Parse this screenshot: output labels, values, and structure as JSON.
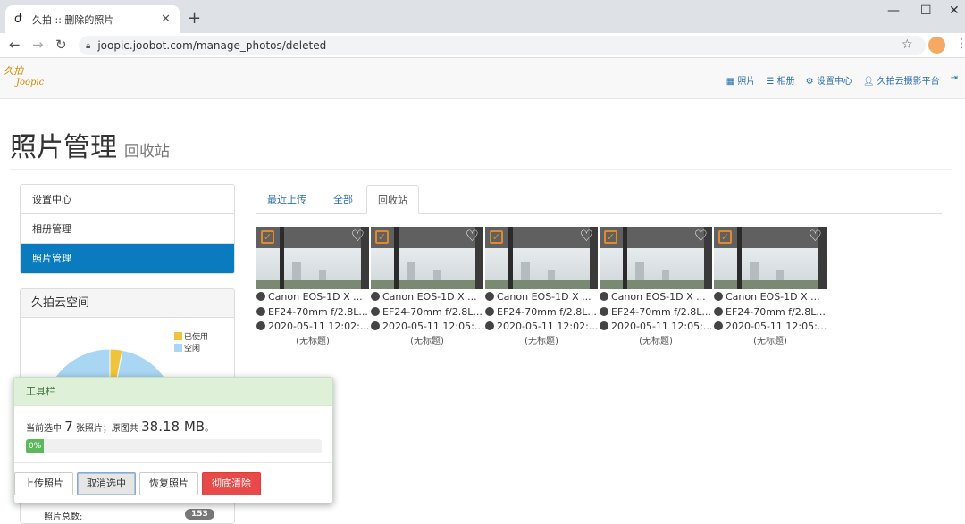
{
  "browser": {
    "tab_title": "久拍 :: 删除的照片",
    "url": "joopic.joobot.com/manage_photos/deleted"
  },
  "header": {
    "logo_line1": "久拍",
    "logo_line2": "Joopic",
    "nav": [
      "照片",
      "相册",
      "设置中心",
      "久拍云摄影平台"
    ]
  },
  "page": {
    "title": "照片管理",
    "subtitle": "回收站"
  },
  "sidebar": {
    "items": [
      "设置中心",
      "相册管理",
      "照片管理"
    ],
    "active_index": 2
  },
  "storage": {
    "title": "久拍云空间",
    "legend_used": "已使用",
    "legend_free": "空闲",
    "used_fraction": 0.03,
    "total_label": "照片总数:",
    "total_count": "153",
    "colors": {
      "used": "#f0c33c",
      "free": "#a8d6f3"
    }
  },
  "tabs": [
    "最近上传",
    "全部",
    "回收站"
  ],
  "photos": [
    {
      "camera": "Canon EOS-1D X ...",
      "lens": "EF24-70mm f/2.8L...",
      "date": "2020-05-11 12:02:...",
      "caption": "(无标题)"
    },
    {
      "camera": "Canon EOS-1D X ...",
      "lens": "EF24-70mm f/2.8L...",
      "date": "2020-05-11 12:05:...",
      "caption": "(无标题)"
    },
    {
      "camera": "Canon EOS-1D X ...",
      "lens": "EF24-70mm f/2.8L...",
      "date": "2020-05-11 12:02:...",
      "caption": "(无标题)"
    },
    {
      "camera": "Canon EOS-1D X ...",
      "lens": "EF24-70mm f/2.8L...",
      "date": "2020-05-11 12:05:...",
      "caption": "(无标题)"
    },
    {
      "camera": "Canon EOS-1D X ...",
      "lens": "EF24-70mm f/2.8L...",
      "date": "2020-05-11 12:05:...",
      "caption": "(无标题)"
    }
  ],
  "toolbar": {
    "title": "工具栏",
    "selected_prefix": "当前选中",
    "selected_count": "7",
    "selected_mid": "张照片；原图共",
    "total_size": "38.18 MB",
    "selected_suffix": "。",
    "progress_label": "0%",
    "progress_fraction": 0.0,
    "buttons": [
      "上传照片",
      "取消选中",
      "恢复照片",
      "彻底清除"
    ]
  }
}
